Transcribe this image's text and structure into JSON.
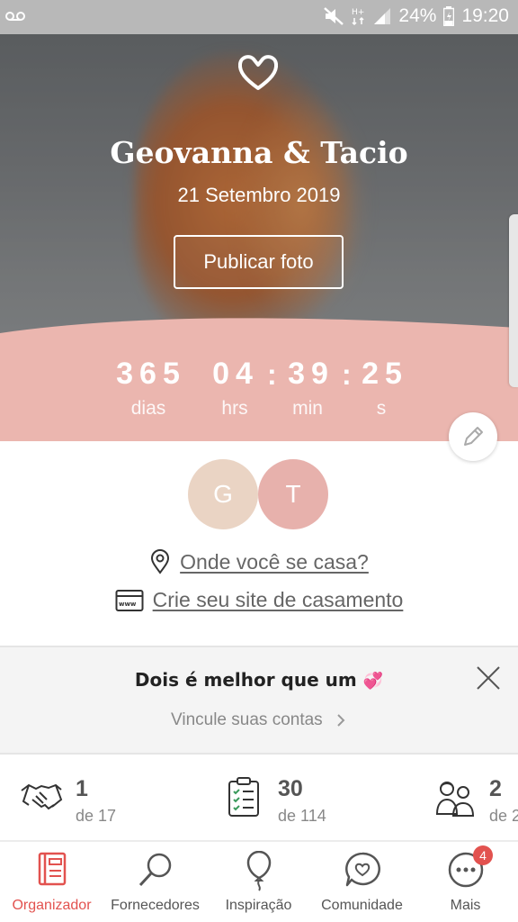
{
  "status_bar": {
    "battery": "24%",
    "time": "19:20",
    "icons": [
      "voicemail-icon",
      "mute-icon",
      "hplus-icon",
      "signal-icon",
      "battery-icon"
    ]
  },
  "hero": {
    "names": "Geovanna & Tacio",
    "date": "21 Setembro 2019",
    "publish_button": "Publicar foto",
    "colors": {
      "band": "#ebb6af"
    }
  },
  "countdown": {
    "days": "365",
    "days_label": "dias",
    "hours": "04",
    "hours_label": "hrs",
    "minutes": "39",
    "minutes_label": "min",
    "seconds": "25",
    "seconds_label": "s",
    "separator": ":"
  },
  "couple": {
    "initial_1": "G",
    "initial_2": "T",
    "colors": {
      "avatar_1": "#ead4c4",
      "avatar_2": "#e7b1ac"
    }
  },
  "links": {
    "venue": "Onde você se casa?",
    "website": "Crie seu site de casamento"
  },
  "link_card": {
    "title": "Dois é melhor que um",
    "title_emoji": "💞",
    "action": "Vincule suas contas"
  },
  "stats": [
    {
      "icon": "handshake-icon",
      "value": "1",
      "of": "de 17"
    },
    {
      "icon": "clipboard-checklist-icon",
      "value": "30",
      "of": "de 114"
    },
    {
      "icon": "guests-icon",
      "value": "2",
      "of": "de 2"
    }
  ],
  "nav": {
    "items": [
      {
        "label": "Organizador",
        "icon": "planner-icon",
        "active": true
      },
      {
        "label": "Fornecedores",
        "icon": "search-icon",
        "active": false
      },
      {
        "label": "Inspiração",
        "icon": "balloon-icon",
        "active": false
      },
      {
        "label": "Comunidade",
        "icon": "chat-heart-icon",
        "active": false
      },
      {
        "label": "Mais",
        "icon": "more-icon",
        "active": false
      }
    ],
    "badge": "4",
    "colors": {
      "active": "#e2524f"
    }
  }
}
